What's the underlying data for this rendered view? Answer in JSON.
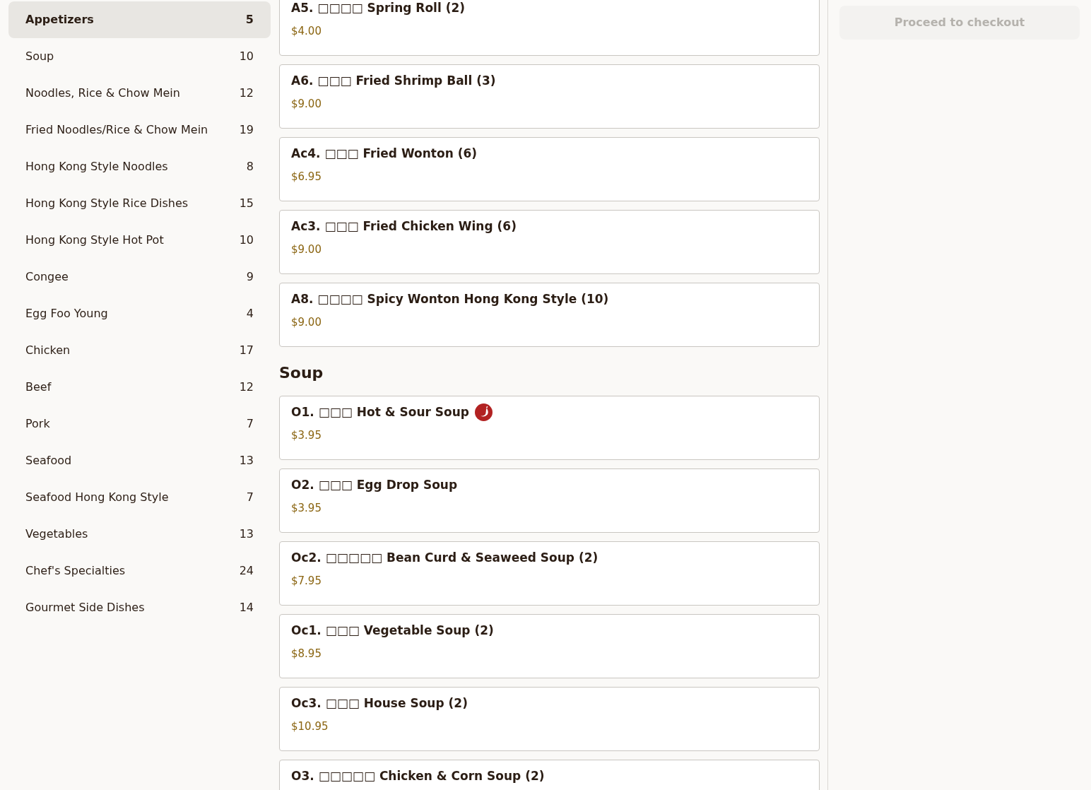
{
  "categories": [
    {
      "name": "Appetizers",
      "count": "5",
      "selected": true
    },
    {
      "name": "Soup",
      "count": "10",
      "selected": false
    },
    {
      "name": "Noodles, Rice & Chow Mein",
      "count": "12",
      "selected": false
    },
    {
      "name": "Fried Noodles/Rice & Chow Mein",
      "count": "19",
      "selected": false
    },
    {
      "name": "Hong Kong Style Noodles",
      "count": "8",
      "selected": false
    },
    {
      "name": "Hong Kong Style Rice Dishes",
      "count": "15",
      "selected": false
    },
    {
      "name": "Hong Kong Style Hot Pot",
      "count": "10",
      "selected": false
    },
    {
      "name": "Congee",
      "count": "9",
      "selected": false
    },
    {
      "name": "Egg Foo Young",
      "count": "4",
      "selected": false
    },
    {
      "name": "Chicken",
      "count": "17",
      "selected": false
    },
    {
      "name": "Beef",
      "count": "12",
      "selected": false
    },
    {
      "name": "Pork",
      "count": "7",
      "selected": false
    },
    {
      "name": "Seafood",
      "count": "13",
      "selected": false
    },
    {
      "name": "Seafood Hong Kong Style",
      "count": "7",
      "selected": false
    },
    {
      "name": "Vegetables",
      "count": "13",
      "selected": false
    },
    {
      "name": "Chef's Specialties",
      "count": "24",
      "selected": false
    },
    {
      "name": "Gourmet Side Dishes",
      "count": "14",
      "selected": false
    }
  ],
  "sections": [
    {
      "items": [
        {
          "name": "A5. □□□□ Spring Roll (2)",
          "price": "$4.00",
          "spicy": false
        },
        {
          "name": "A6. □□□ Fried Shrimp Ball (3)",
          "price": "$9.00",
          "spicy": false
        },
        {
          "name": "Ac4. □□□ Fried Wonton (6)",
          "price": "$6.95",
          "spicy": false
        },
        {
          "name": "Ac3. □□□ Fried Chicken Wing (6)",
          "price": "$9.00",
          "spicy": false
        },
        {
          "name": "A8. □□□□ Spicy Wonton Hong Kong Style (10)",
          "price": "$9.00",
          "spicy": false
        }
      ]
    },
    {
      "title": "Soup",
      "items": [
        {
          "name": "O1. □□□ Hot & Sour Soup",
          "price": "$3.95",
          "spicy": true
        },
        {
          "name": "O2. □□□ Egg Drop Soup",
          "price": "$3.95",
          "spicy": false
        },
        {
          "name": "Oc2. □□□□□ Bean Curd & Seaweed Soup (2)",
          "price": "$7.95",
          "spicy": false
        },
        {
          "name": "Oc1. □□□ Vegetable Soup (2)",
          "price": "$8.95",
          "spicy": false
        },
        {
          "name": "Oc3. □□□ House Soup (2)",
          "price": "$10.95",
          "spicy": false
        },
        {
          "name": "O3. □□□□□ Chicken & Corn Soup (2)",
          "spicy": false
        }
      ]
    }
  ],
  "checkout": {
    "label": "Proceed to checkout",
    "disabled": true
  }
}
